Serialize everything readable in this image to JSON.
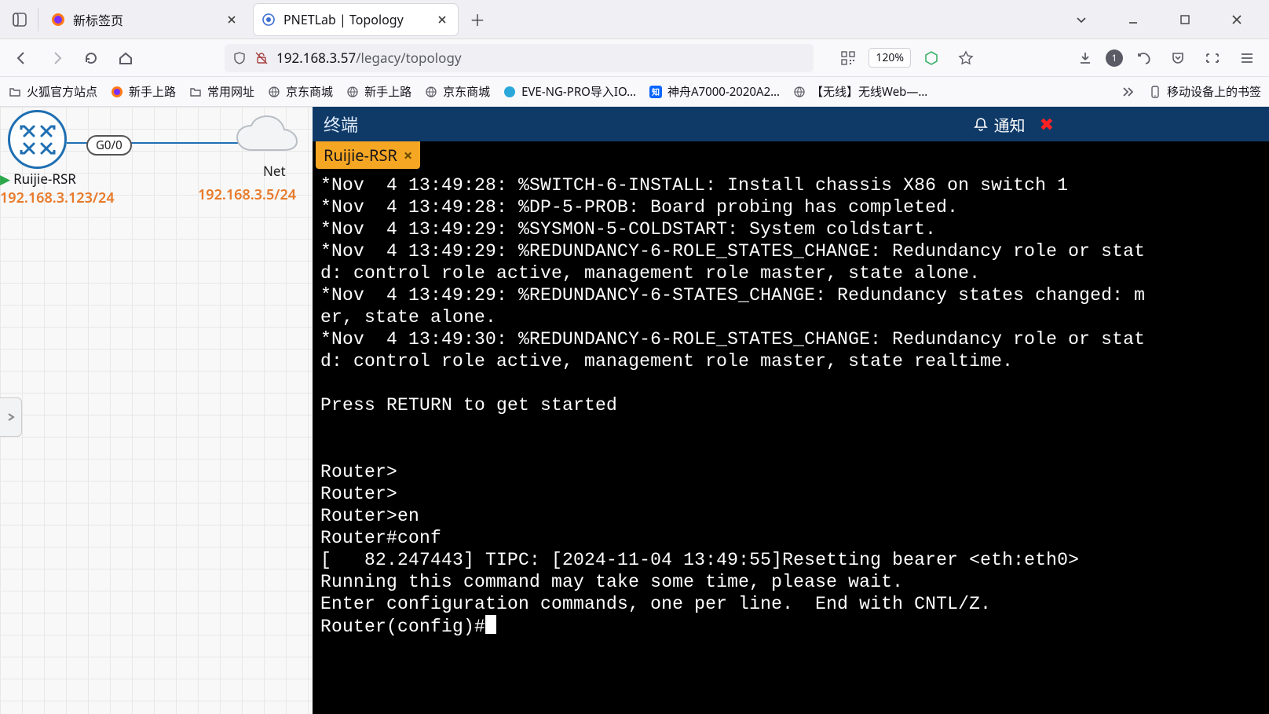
{
  "browser": {
    "tabs": [
      {
        "title": "新标签页",
        "active": false
      },
      {
        "title": "PNETLab | Topology",
        "active": true
      }
    ],
    "url_host": "192.168.3.57",
    "url_path": "/legacy/topology",
    "zoom": "120%",
    "notification_count": "1"
  },
  "bookmarks": {
    "items": [
      "火狐官方站点",
      "新手上路",
      "常用网址",
      "京东商城",
      "新手上路",
      "京东商城",
      "EVE-NG-PRO导入IO…",
      "神舟A7000-2020A2…",
      "【无线】无线Web—…"
    ],
    "mobile_label": "移动设备上的书签"
  },
  "topology": {
    "router": {
      "label": "Ruijie-RSR",
      "ip": "192.168.3.123/24",
      "link_label": "G0/0"
    },
    "cloud": {
      "label": "Net",
      "ip": "192.168.3.5/24"
    }
  },
  "terminal": {
    "window_title": "终端",
    "notify_label": "通知",
    "tab_label": "Ruijie-RSR",
    "output": "*Nov  4 13:49:28: %SWITCH-6-INSTALL: Install chassis X86 on switch 1\n*Nov  4 13:49:28: %DP-5-PROB: Board probing has completed.\n*Nov  4 13:49:29: %SYSMON-5-COLDSTART: System coldstart.\n*Nov  4 13:49:29: %REDUNDANCY-6-ROLE_STATES_CHANGE: Redundancy role or stat\nd: control role active, management role master, state alone.\n*Nov  4 13:49:29: %REDUNDANCY-6-STATES_CHANGE: Redundancy states changed: m\ner, state alone.\n*Nov  4 13:49:30: %REDUNDANCY-6-ROLE_STATES_CHANGE: Redundancy role or stat\nd: control role active, management role master, state realtime.\n\nPress RETURN to get started\n\n\nRouter>\nRouter>\nRouter>en\nRouter#conf\n[   82.247443] TIPC: [2024-11-04 13:49:55]Resetting bearer <eth:eth0>\nRunning this command may take some time, please wait.\nEnter configuration commands, one per line.  End with CNTL/Z.\nRouter(config)#"
  }
}
